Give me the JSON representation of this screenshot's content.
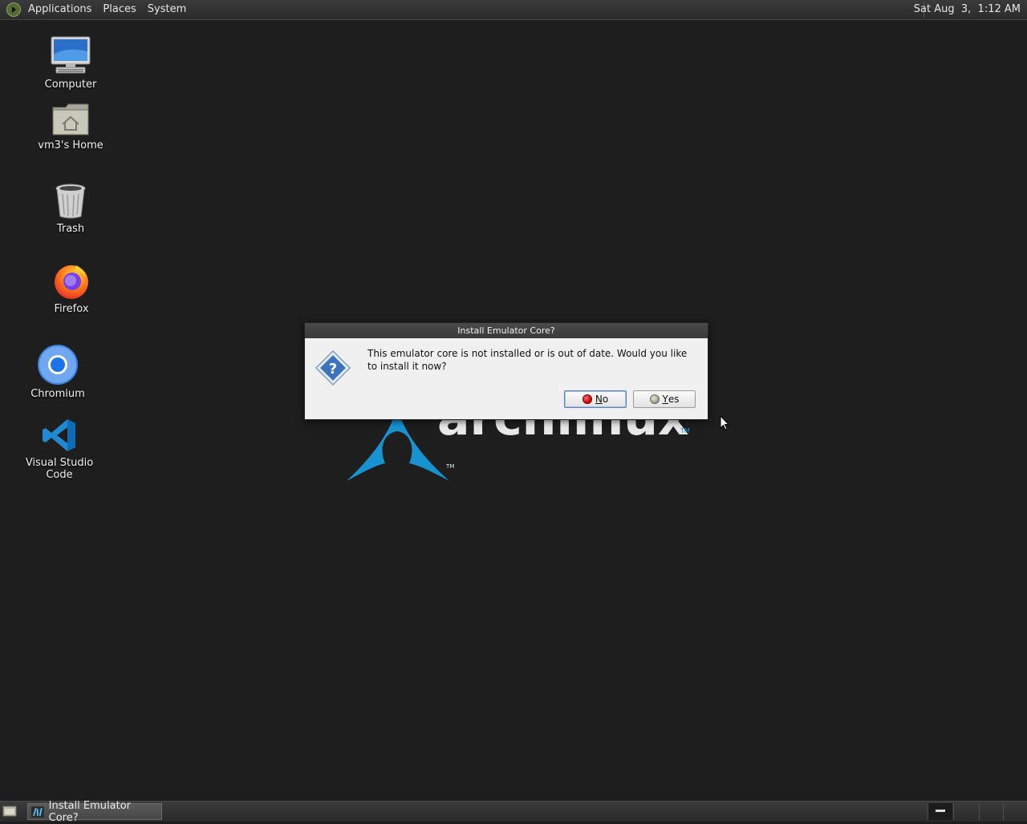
{
  "top_panel": {
    "menus": [
      "Applications",
      "Places",
      "System"
    ],
    "clock": "Sat Aug  3,  1:12 AM"
  },
  "desktop": {
    "icons": [
      {
        "label": "Computer",
        "icon": "computer-icon"
      },
      {
        "label": "vm3's Home",
        "icon": "home-folder-icon"
      },
      {
        "label": "Trash",
        "icon": "trash-icon"
      },
      {
        "label": "Firefox",
        "icon": "firefox-icon"
      },
      {
        "label": "Chromium",
        "icon": "chromium-icon"
      },
      {
        "label": "Visual Studio Code",
        "icon": "vscode-icon"
      }
    ],
    "wallpaper_text": "archlinux",
    "wallpaper_tm": "TM"
  },
  "dialog": {
    "title": "Install Emulator Core?",
    "message": "This emulator core is not installed or is out of date. Would you like to install it now?",
    "no_label_mnemonic": "N",
    "no_label_rest": "o",
    "yes_label_mnemonic": "Y",
    "yes_label_rest": "es"
  },
  "taskbar": {
    "task_label": "Install Emulator Core?"
  },
  "colors": {
    "arch_blue": "#1793d1",
    "desktop_bg": "#1e1e1e"
  }
}
